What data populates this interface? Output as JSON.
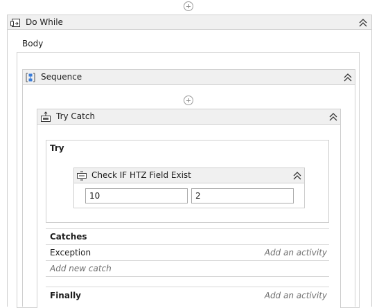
{
  "do_while": {
    "title": "Do While",
    "body_label": "Body"
  },
  "sequence": {
    "title": "Sequence"
  },
  "try_catch": {
    "title": "Try Catch",
    "try_label": "Try",
    "catches_label": "Catches",
    "finally_label": "Finally",
    "exception_type": "Exception",
    "exception_action": "Add an activity",
    "add_new_catch": "Add new catch",
    "finally_action": "Add an activity"
  },
  "check_activity": {
    "title": "Check IF HTZ Field Exist",
    "field1_value": "10",
    "field2_value": "2"
  },
  "icons": {
    "do_while": "loop-activity-icon",
    "sequence": "sequence-activity-icon",
    "try_catch": "try-catch-activity-icon",
    "check": "check-activity-icon",
    "collapse": "double-chevron-up-icon",
    "add": "plus-circle-icon"
  }
}
